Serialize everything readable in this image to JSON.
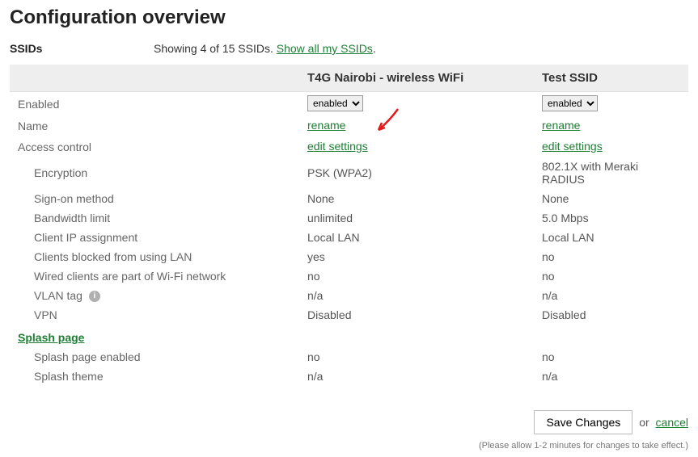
{
  "page": {
    "title": "Configuration overview",
    "ssids_label": "SSIDs",
    "showing_text": "Showing 4 of 15 SSIDs. ",
    "show_all_link": "Show all my SSIDs",
    "period": "."
  },
  "columns": {
    "blank": "",
    "col1": "T4G Nairobi - wireless WiFi",
    "col2": "Test SSID"
  },
  "dropdown_label": "enabled",
  "labels": {
    "enabled": "Enabled",
    "name": "Name",
    "access_control": "Access control",
    "encryption": "Encryption",
    "sign_on": "Sign-on method",
    "bandwidth": "Bandwidth limit",
    "client_ip": "Client IP assignment",
    "clients_blocked": "Clients blocked from using LAN",
    "wired_clients": "Wired clients are part of Wi-Fi network",
    "vlan_tag": "VLAN tag",
    "vpn": "VPN",
    "splash_page": "Splash page",
    "splash_enabled": "Splash page enabled",
    "splash_theme": "Splash theme"
  },
  "links": {
    "rename": "rename",
    "edit_settings": "edit settings"
  },
  "ssid1": {
    "encryption": "PSK (WPA2)",
    "sign_on": "None",
    "bandwidth": "unlimited",
    "client_ip": "Local LAN",
    "clients_blocked": "yes",
    "wired_clients": "no",
    "vlan_tag": "n/a",
    "vpn": "Disabled",
    "splash_enabled": "no",
    "splash_theme": "n/a"
  },
  "ssid2": {
    "encryption": "802.1X with Meraki RADIUS",
    "sign_on": "None",
    "bandwidth": "5.0 Mbps",
    "client_ip": "Local LAN",
    "clients_blocked": "no",
    "wired_clients": "no",
    "vlan_tag": "n/a",
    "vpn": "Disabled",
    "splash_enabled": "no",
    "splash_theme": "n/a"
  },
  "footer": {
    "save": "Save Changes",
    "or": "or",
    "cancel": "cancel",
    "note": "(Please allow 1-2 minutes for changes to take effect.)"
  }
}
